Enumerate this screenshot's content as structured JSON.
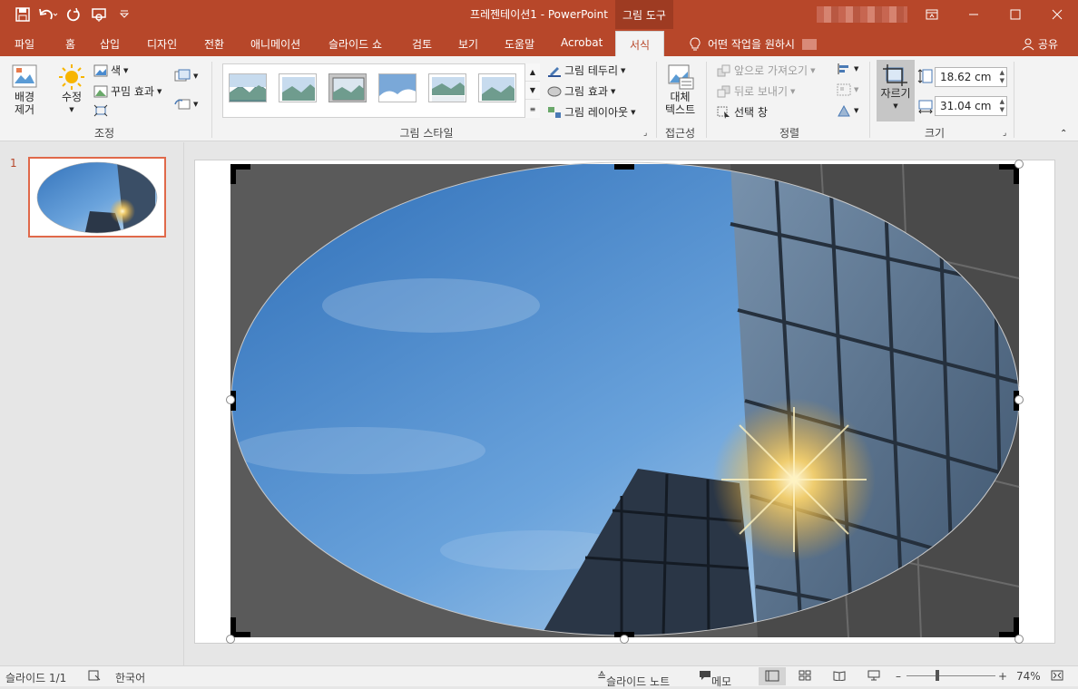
{
  "app": {
    "title": "프레젠테이션1  -  PowerPoint",
    "context_tool": "그림 도구"
  },
  "tabs": [
    {
      "label": "파일"
    },
    {
      "label": "홈"
    },
    {
      "label": "삽입"
    },
    {
      "label": "디자인"
    },
    {
      "label": "전환"
    },
    {
      "label": "애니메이션"
    },
    {
      "label": "슬라이드 쇼"
    },
    {
      "label": "검토"
    },
    {
      "label": "보기"
    },
    {
      "label": "도움말"
    },
    {
      "label": "Acrobat"
    },
    {
      "label": "서식"
    }
  ],
  "tell_me": "어떤 작업을 원하시",
  "share": "공유",
  "ribbon": {
    "adjust": {
      "remove_bg": "배경\n제거",
      "corrections": "수정",
      "color": "색",
      "artistic": "꾸밈 효과",
      "label": "조정"
    },
    "styles": {
      "border": "그림 테두리",
      "effects": "그림 효과",
      "layout": "그림 레이아웃",
      "label": "그림 스타일"
    },
    "access": {
      "alt_text": "대체\n텍스트",
      "label": "접근성"
    },
    "arrange": {
      "bring_forward": "앞으로 가져오기",
      "send_backward": "뒤로 보내기",
      "selection_pane": "선택 창",
      "label": "정렬"
    },
    "size": {
      "crop": "자르기",
      "height": "18.62 cm",
      "width": "31.04 cm",
      "label": "크기"
    }
  },
  "slides": [
    {
      "number": "1"
    }
  ],
  "status": {
    "slide": "슬라이드 1/1",
    "language": "한국어",
    "notes": "슬라이드 노트",
    "comments": "메모",
    "zoom": "74%"
  }
}
